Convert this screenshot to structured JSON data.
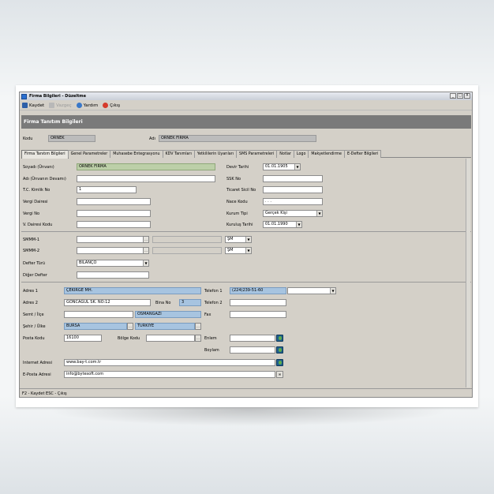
{
  "window": {
    "title": "Firma Bilgileri - Düzeltme",
    "controls": [
      "_",
      "□",
      "X"
    ]
  },
  "toolbar": {
    "save": "Kaydet",
    "undo": "Vazgeç",
    "help": "Yardım",
    "exit": "Çıkış"
  },
  "header": {
    "title": "Firma Tanıtım Bilgileri"
  },
  "top": {
    "code_label": "Kodu",
    "code_value": "ORNEK",
    "name_label": "Adı",
    "name_value": "ÖRNEK FİRMA"
  },
  "tabs": [
    "Firma Tanıtım Bilgileri",
    "Genel Parametreler",
    "Muhasebe Entegrasyonu",
    "KDV Tanımları",
    "Yetkililerin Uyarıları",
    "SMS Parametreleri",
    "Notlar",
    "Logo",
    "Makyetlendirme",
    "E-Defter Bilgileri"
  ],
  "form": {
    "soyadi_label": "Soyadı (Ünvanı)",
    "soyadi_value": "ÖRNEK FİRMA",
    "adi_label": "Adı (Ünvanın Devamı)",
    "adi_value": "",
    "tc_label": "T.C. Kimlik No",
    "tc_value": "1",
    "vd_label": "Vergi Dairesi",
    "vno_label": "Vergi No",
    "vdk_label": "V. Dairesi Kodu",
    "devir_label": "Devir Tarihi",
    "devir_value": "01.01.1905",
    "ssk_label": "SSK No",
    "sicil_label": "Ticaret Sicil No",
    "nace_label": "Nace Kodu",
    "nace_value": ". . .",
    "kurum_label": "Kurum Tipi",
    "kurum_value": "Gerçek Kişi",
    "kurulus_label": "Kuruluş Tarihi",
    "kurulus_value": "01.01.1990",
    "smmm1_label": "SMMM-1",
    "smmm2_label": "SMMM-2",
    "smmm_sel": "ŞM",
    "defter_label": "Defter Türü",
    "defter_value": "BİLANÇO",
    "diger_label": "Diğer Defter",
    "adres1_label": "Adres 1",
    "adres1_value": "ÇEKİRGE MH.",
    "adres2_label": "Adres 2",
    "adres2_value": "GONCAGÜL SK. NO:12",
    "bina_label": "Bina No",
    "bina_value": "3",
    "semt_label": "Semt / İlçe",
    "semt_value": "OSMANGAZİ",
    "sehir_label": "Şehir / Ülke",
    "sehir_value": "BURSA",
    "ulke_value": "TÜRKİYE",
    "posta_label": "Posta Kodu",
    "posta_value": "16100",
    "bolge_label": "Bölge Kodu",
    "tel1_label": "Telefon 1",
    "tel1_value": "(224)239-51-60",
    "tel2_label": "Telefon 2",
    "fax_label": "Fax",
    "enlem_label": "Enlem",
    "boylam_label": "Boylam",
    "internet_label": "Internet Adresi",
    "internet_value": "www.bay-t.com.tr",
    "eposta_label": "E-Posta Adresi",
    "eposta_value": "info@bytesoft.com"
  },
  "status": "F2 - Kaydet  ESC - Çıkış"
}
